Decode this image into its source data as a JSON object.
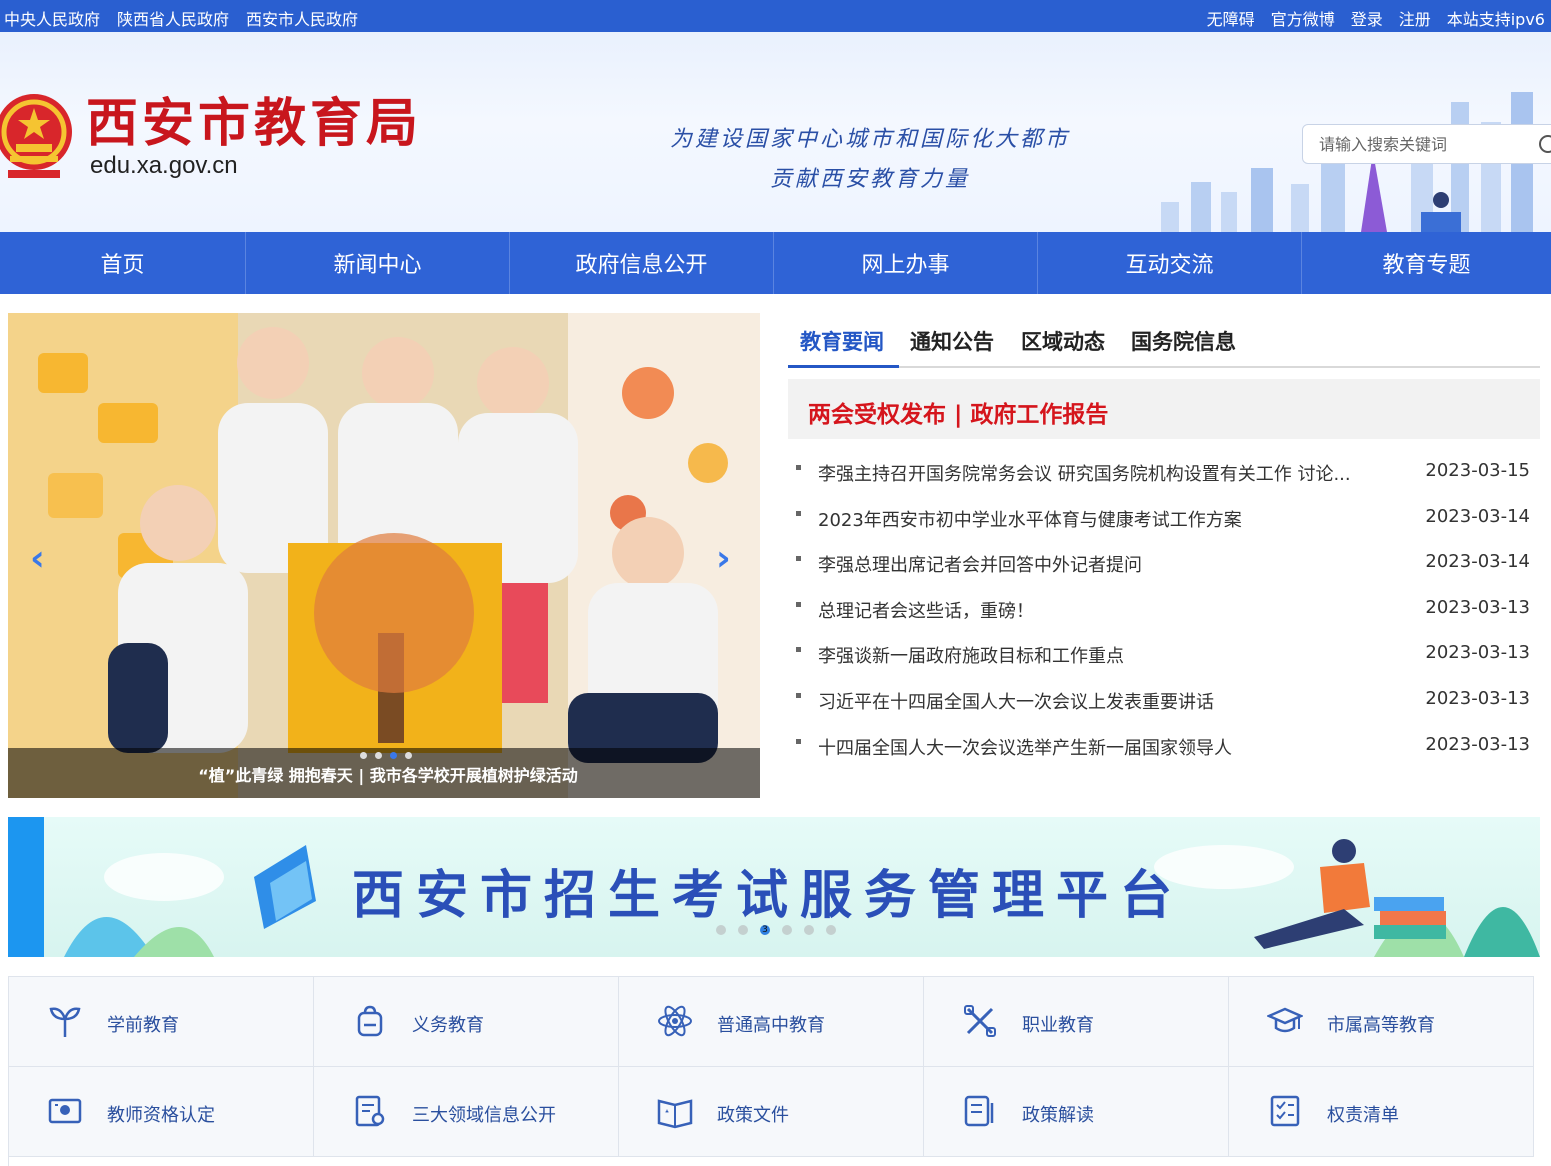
{
  "topbar": {
    "left_links": [
      "中央人民政府",
      "陕西省人民政府",
      "西安市人民政府"
    ],
    "right_links": [
      "无障碍",
      "官方微博",
      "登录",
      "注册",
      "本站支持ipv6"
    ]
  },
  "header": {
    "site_title": "西安市教育局",
    "site_url": "edu.xa.gov.cn",
    "slogan_line1": "为建设国家中心城市和国际化大都市",
    "slogan_line2": "贡献西安教育力量",
    "search_placeholder": "请输入搜索关键词"
  },
  "nav": [
    "首页",
    "新闻中心",
    "政府信息公开",
    "网上办事",
    "互动交流",
    "教育专题"
  ],
  "carousel": {
    "caption": "“植”此青绿 拥抱春天 | 我市各学校开展植树护绿活动",
    "slide_count": 4,
    "active_slide": 3
  },
  "news": {
    "tabs": [
      "教育要闻",
      "通知公告",
      "区域动态",
      "国务院信息"
    ],
    "active_tab": 0,
    "headline": "两会受权发布 | 政府工作报告",
    "items": [
      {
        "title": "李强主持召开国务院常务会议 研究国务院机构设置有关工作 讨论...",
        "date": "2023-03-15"
      },
      {
        "title": "2023年西安市初中学业水平体育与健康考试工作方案",
        "date": "2023-03-14"
      },
      {
        "title": "李强总理出席记者会并回答中外记者提问",
        "date": "2023-03-14"
      },
      {
        "title": "总理记者会这些话，重磅！",
        "date": "2023-03-13"
      },
      {
        "title": "李强谈新一届政府施政目标和工作重点",
        "date": "2023-03-13"
      },
      {
        "title": "习近平在十四届全国人大一次会议上发表重要讲话",
        "date": "2023-03-13"
      },
      {
        "title": "十四届全国人大一次会议选举产生新一届国家领导人",
        "date": "2023-03-13"
      }
    ]
  },
  "banner": {
    "title": "西安市招生考试服务管理平台",
    "dot_label": "3",
    "dot_count": 6,
    "active_dot": 2
  },
  "services": [
    {
      "label": "学前教育",
      "icon": "sprout-icon"
    },
    {
      "label": "义务教育",
      "icon": "schoolbag-icon"
    },
    {
      "label": "普通高中教育",
      "icon": "atom-icon"
    },
    {
      "label": "职业教育",
      "icon": "tools-icon"
    },
    {
      "label": "市属高等教育",
      "icon": "graduation-cap-icon"
    },
    {
      "label": "教师资格认定",
      "icon": "id-card-icon"
    },
    {
      "label": "三大领域信息公开",
      "icon": "document-search-icon"
    },
    {
      "label": "政策文件",
      "icon": "open-book-icon"
    },
    {
      "label": "政策解读",
      "icon": "policy-file-icon"
    },
    {
      "label": "权责清单",
      "icon": "checklist-icon"
    }
  ],
  "colors": {
    "primary_blue": "#2f63d6",
    "title_red": "#c8161d",
    "headline_red": "#d5151c",
    "link_blue": "#2a4f9e"
  }
}
